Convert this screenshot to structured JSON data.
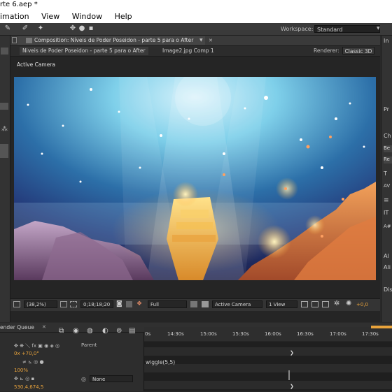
{
  "window": {
    "title": "rte 6.aep *"
  },
  "menu": [
    "imation",
    "View",
    "Window",
    "Help"
  ],
  "toolbar": {
    "workspace_label": "Workspace:",
    "workspace_value": "Standard"
  },
  "composition": {
    "panel_tab": "Composition: Níveis de Poder Poseidon - parte 5 para o After",
    "subtabs": [
      "Niveis de Poder Poseidon - parte 5 para o After",
      "Image2.jpg Comp 1"
    ],
    "renderer_label": "Renderer:",
    "renderer_value": "Classic 3D",
    "active_camera_label": "Active Camera"
  },
  "viewer_bar": {
    "zoom": "(38,2%)",
    "timecode": "0;18;18;20",
    "resolution": "Full",
    "camera": "Active Camera",
    "views": "1 View",
    "exposure": "+0,0"
  },
  "right_panel": {
    "letters": [
      "In",
      "Pr",
      "Ch",
      "Be",
      "Re",
      "Al",
      "Ali",
      "Dis"
    ]
  },
  "timeline": {
    "tab": "ender Queue",
    "parent_label": "Parent",
    "ruler": [
      "0s",
      "14:30s",
      "15:00s",
      "15:30s",
      "16:00s",
      "16:30s",
      "17:00s",
      "17:30s"
    ],
    "rotation_value": "0x +70,0°",
    "expression": "wiggle(5,5)",
    "opacity_value": "100%",
    "parent_value": "None",
    "position_value": "530,4,674,5"
  },
  "colors": {
    "accent_orange": "#e9a33b",
    "panel_bg": "#2a2a2a"
  }
}
